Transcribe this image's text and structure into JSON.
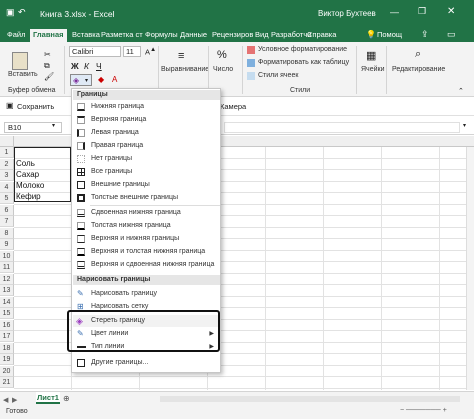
{
  "window": {
    "title": "Книга 3.xlsx  -  Excel",
    "user": "Виктор Бухтеев"
  },
  "tabs": [
    "Файл",
    "Главная",
    "Вставка",
    "Разметка ст",
    "Формулы",
    "Данные",
    "Рецензиров",
    "Вид",
    "Разработчи",
    "Справка",
    "Помощ"
  ],
  "ribbon": {
    "paste": "Вставить",
    "clipboard_group": "Буфер обмена",
    "font_name": "Calibri",
    "font_size": "11",
    "alignment": "Выравнивание",
    "number": "Число",
    "cond_format": "Условное форматирование",
    "format_table": "Форматировать как таблицу",
    "cell_styles": "Стили ячеек",
    "styles_group": "Стили",
    "cells": "Ячейки",
    "editing": "Редактирование"
  },
  "quick_access": {
    "save": "Сохранить",
    "camera": "Камера"
  },
  "formula_bar": {
    "name_box": "B10",
    "formula": ""
  },
  "grid": {
    "rows": [
      "1",
      "2",
      "3",
      "4",
      "5",
      "6",
      "7",
      "8",
      "9",
      "10",
      "11",
      "12",
      "13",
      "14",
      "15",
      "16",
      "17",
      "18",
      "19",
      "20",
      "21"
    ],
    "values": [
      "",
      "Соль",
      "Сахар",
      "Молоко",
      "Кефир"
    ]
  },
  "border_menu": {
    "header_borders": "Границы",
    "items": [
      "Нижняя граница",
      "Верхняя граница",
      "Левая граница",
      "Правая граница",
      "Нет границы",
      "Все границы",
      "Внешние границы",
      "Толстые внешние границы",
      "Сдвоенная нижняя граница",
      "Толстая нижняя граница",
      "Верхняя и нижняя границы",
      "Верхняя и толстая нижняя граница",
      "Верхняя и сдвоенная нижняя граница"
    ],
    "header_draw": "Нарисовать границы",
    "draw_items": [
      "Нарисовать границу",
      "Нарисовать сетку",
      "Стереть границу",
      "Цвет линии",
      "Тип линии",
      "Другие границы..."
    ]
  },
  "status": {
    "ready": "Готово",
    "sheet": "Лист1"
  }
}
